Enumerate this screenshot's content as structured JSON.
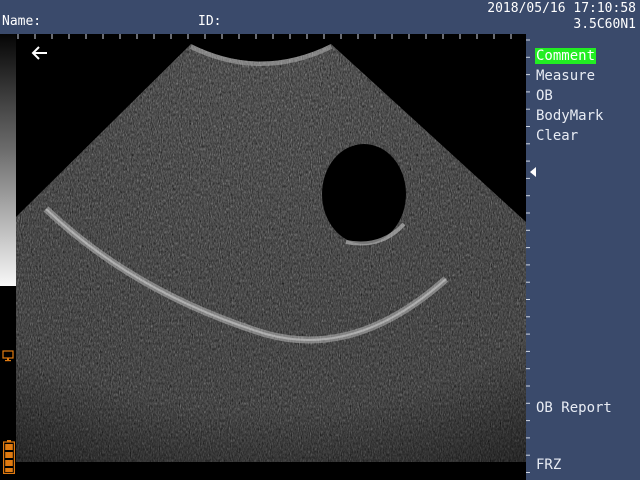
{
  "header": {
    "name_label": "Name:",
    "id_label": "ID:",
    "datetime": "2018/05/16 17:10:58",
    "probe": "3.5C60N1"
  },
  "menu": {
    "items": [
      {
        "label": "Comment",
        "active": true
      },
      {
        "label": "Measure",
        "active": false
      },
      {
        "label": "OB",
        "active": false
      },
      {
        "label": "BodyMark",
        "active": false
      },
      {
        "label": "Clear",
        "active": false
      }
    ],
    "ob_report": "OB Report",
    "freeze": "FRZ"
  },
  "icons": {
    "back": "back-arrow-icon",
    "monitor": "monitor-icon",
    "battery": "battery-icon",
    "focus": "focus-marker-icon"
  },
  "colors": {
    "panel": "#3a4a6b",
    "active_highlight": "#22ee22",
    "status_orange": "#e07a10"
  }
}
